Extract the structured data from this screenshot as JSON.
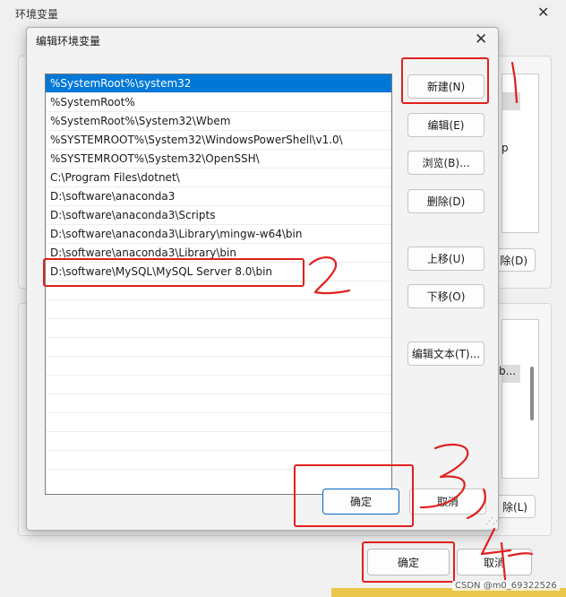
{
  "background_window": {
    "title": "环境变量",
    "fragment_p": "p",
    "fragment_delete1": "除(D)",
    "fragment_yb": "/b...",
    "fragment_delete2": "除(L)",
    "ok_label": "确定",
    "cancel_label": "取消"
  },
  "dialog": {
    "title": "编辑环境变量",
    "paths": [
      "%SystemRoot%\\system32",
      "%SystemRoot%",
      "%SystemRoot%\\System32\\Wbem",
      "%SYSTEMROOT%\\System32\\WindowsPowerShell\\v1.0\\",
      "%SYSTEMROOT%\\System32\\OpenSSH\\",
      "C:\\Program Files\\dotnet\\",
      "D:\\software\\anaconda3",
      "D:\\software\\anaconda3\\Scripts",
      "D:\\software\\anaconda3\\Library\\mingw-w64\\bin",
      "D:\\software\\anaconda3\\Library\\bin",
      "D:\\software\\MySQL\\MySQL Server 8.0\\bin"
    ],
    "buttons": {
      "new": "新建(N)",
      "edit": "编辑(E)",
      "browse": "浏览(B)...",
      "delete": "删除(D)",
      "move_up": "上移(U)",
      "move_down": "下移(O)",
      "edit_text": "编辑文本(T)...",
      "ok": "确定",
      "cancel": "取消"
    }
  },
  "watermark": "CSDN @m0_69322526",
  "colors": {
    "selection": "#0078d7",
    "annotation": "#e0201e"
  }
}
